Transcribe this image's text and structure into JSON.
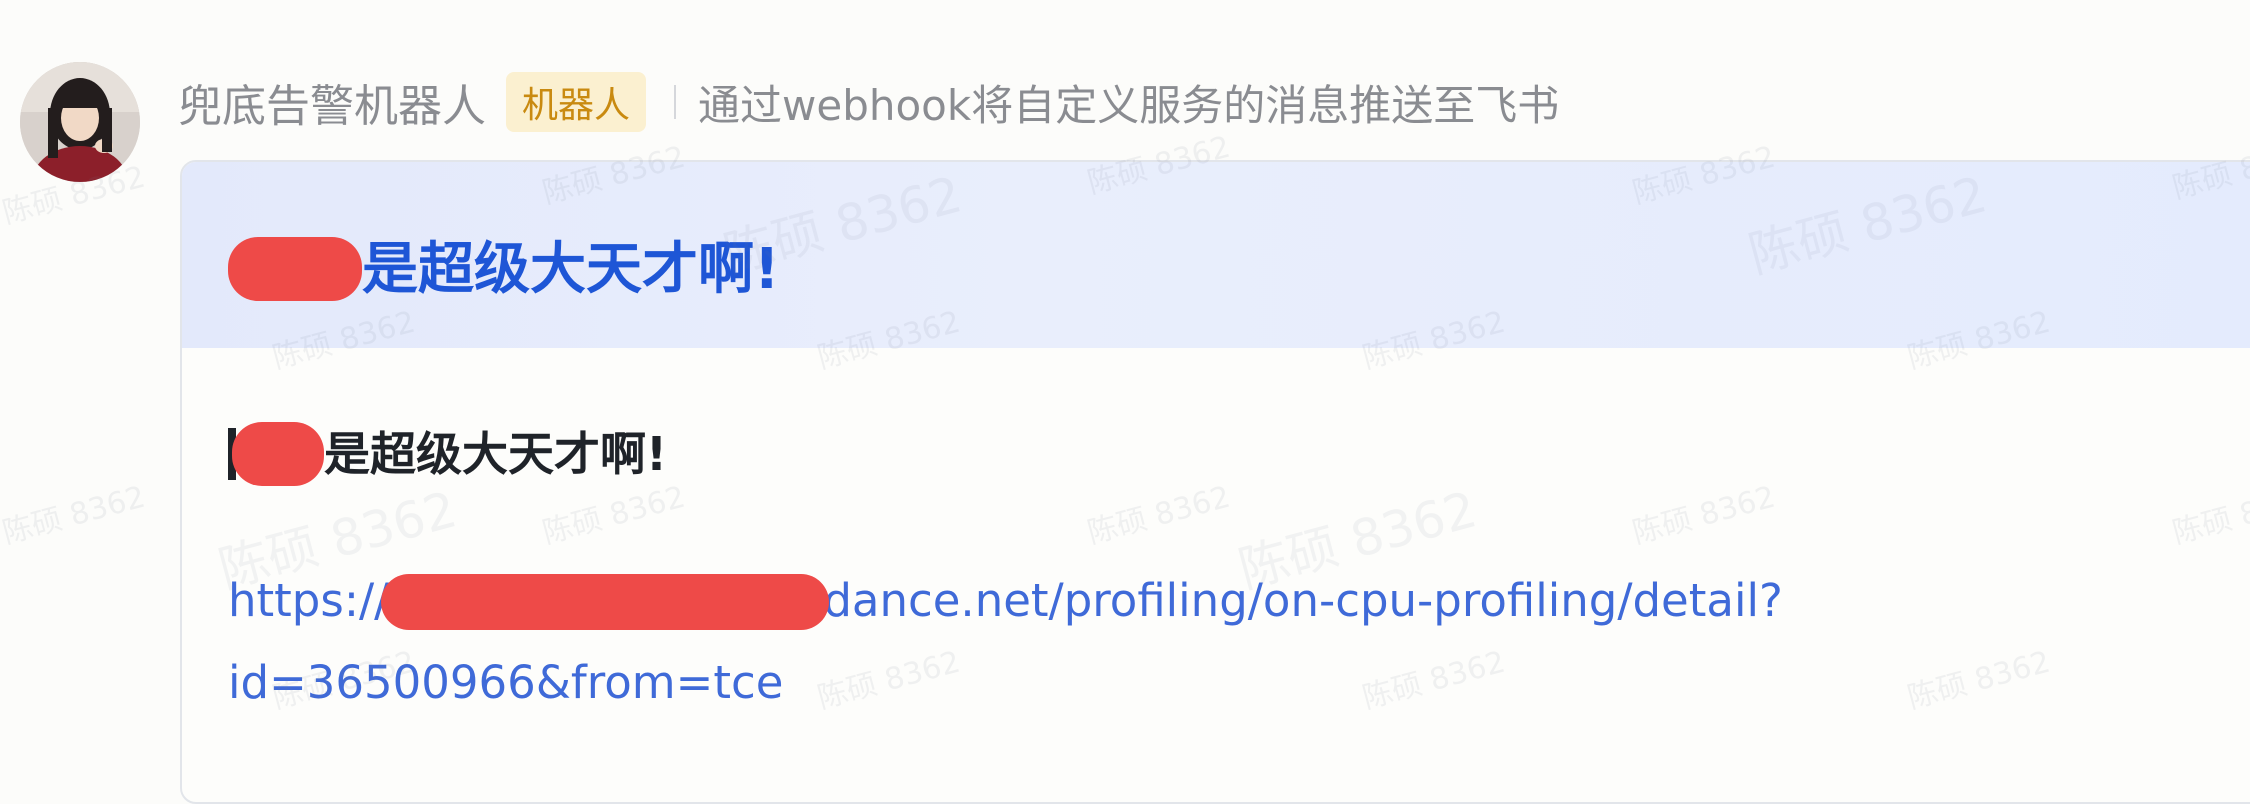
{
  "message": {
    "sender_name": "兜底告警机器人",
    "bot_badge": "机器人",
    "bot_description": "通过webhook将自定义服务的消息推送至飞书"
  },
  "card": {
    "title": "是超级大天才啊!",
    "body_text": "是超级大天才啊!",
    "link_prefix": "https://",
    "link_suffix": "dance.net/profiling/on-cpu-profiling/detail?",
    "link_line2": "id=36500966&from=tce"
  },
  "watermark": {
    "text": "陈硕 8362"
  },
  "colors": {
    "card_title": "#1e56d6",
    "link": "#3f6ad8",
    "badge_bg": "#fbf0d0",
    "badge_text": "#c98a10",
    "redaction": "#ee4a48"
  }
}
